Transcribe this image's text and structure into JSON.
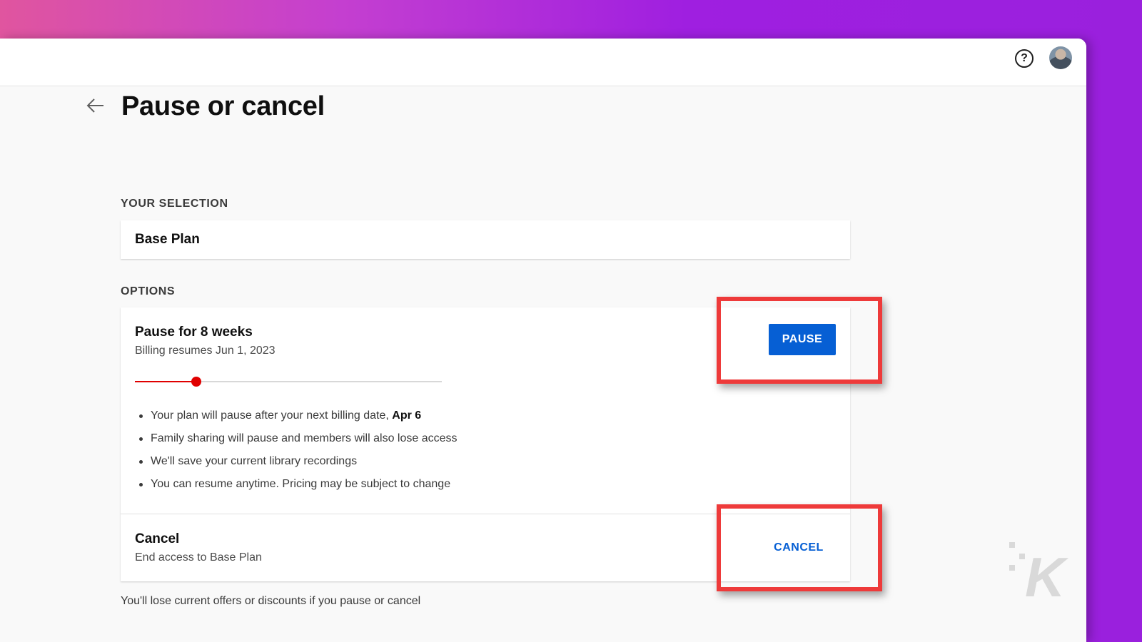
{
  "colors": {
    "accent": "#065fd4",
    "slider": "#e00000",
    "highlight": "#ee3a3a"
  },
  "header": {
    "help_icon": "?",
    "avatar_icon": "avatar"
  },
  "page": {
    "back_icon": "arrow-left-icon",
    "title": "Pause or cancel"
  },
  "selection": {
    "label": "YOUR SELECTION",
    "value": "Base Plan"
  },
  "options": {
    "label": "OPTIONS",
    "pause": {
      "title": "Pause for 8 weeks",
      "subtitle": "Billing resumes Jun 1, 2023",
      "slider_value_fraction": 0.2,
      "button_label": "PAUSE",
      "bullets": [
        {
          "text": "Your plan will pause after your next billing date, ",
          "bold": "Apr 6"
        },
        {
          "text": "Family sharing will pause and members will also lose access",
          "bold": ""
        },
        {
          "text": "We'll save your current library recordings",
          "bold": ""
        },
        {
          "text": "You can resume anytime. Pricing may be subject to change",
          "bold": ""
        }
      ]
    },
    "cancel": {
      "title": "Cancel",
      "subtitle": "End access to Base Plan",
      "button_label": "CANCEL"
    }
  },
  "footnote": "You'll lose current offers or discounts if you pause or cancel",
  "watermark": {
    "letter": "K"
  }
}
